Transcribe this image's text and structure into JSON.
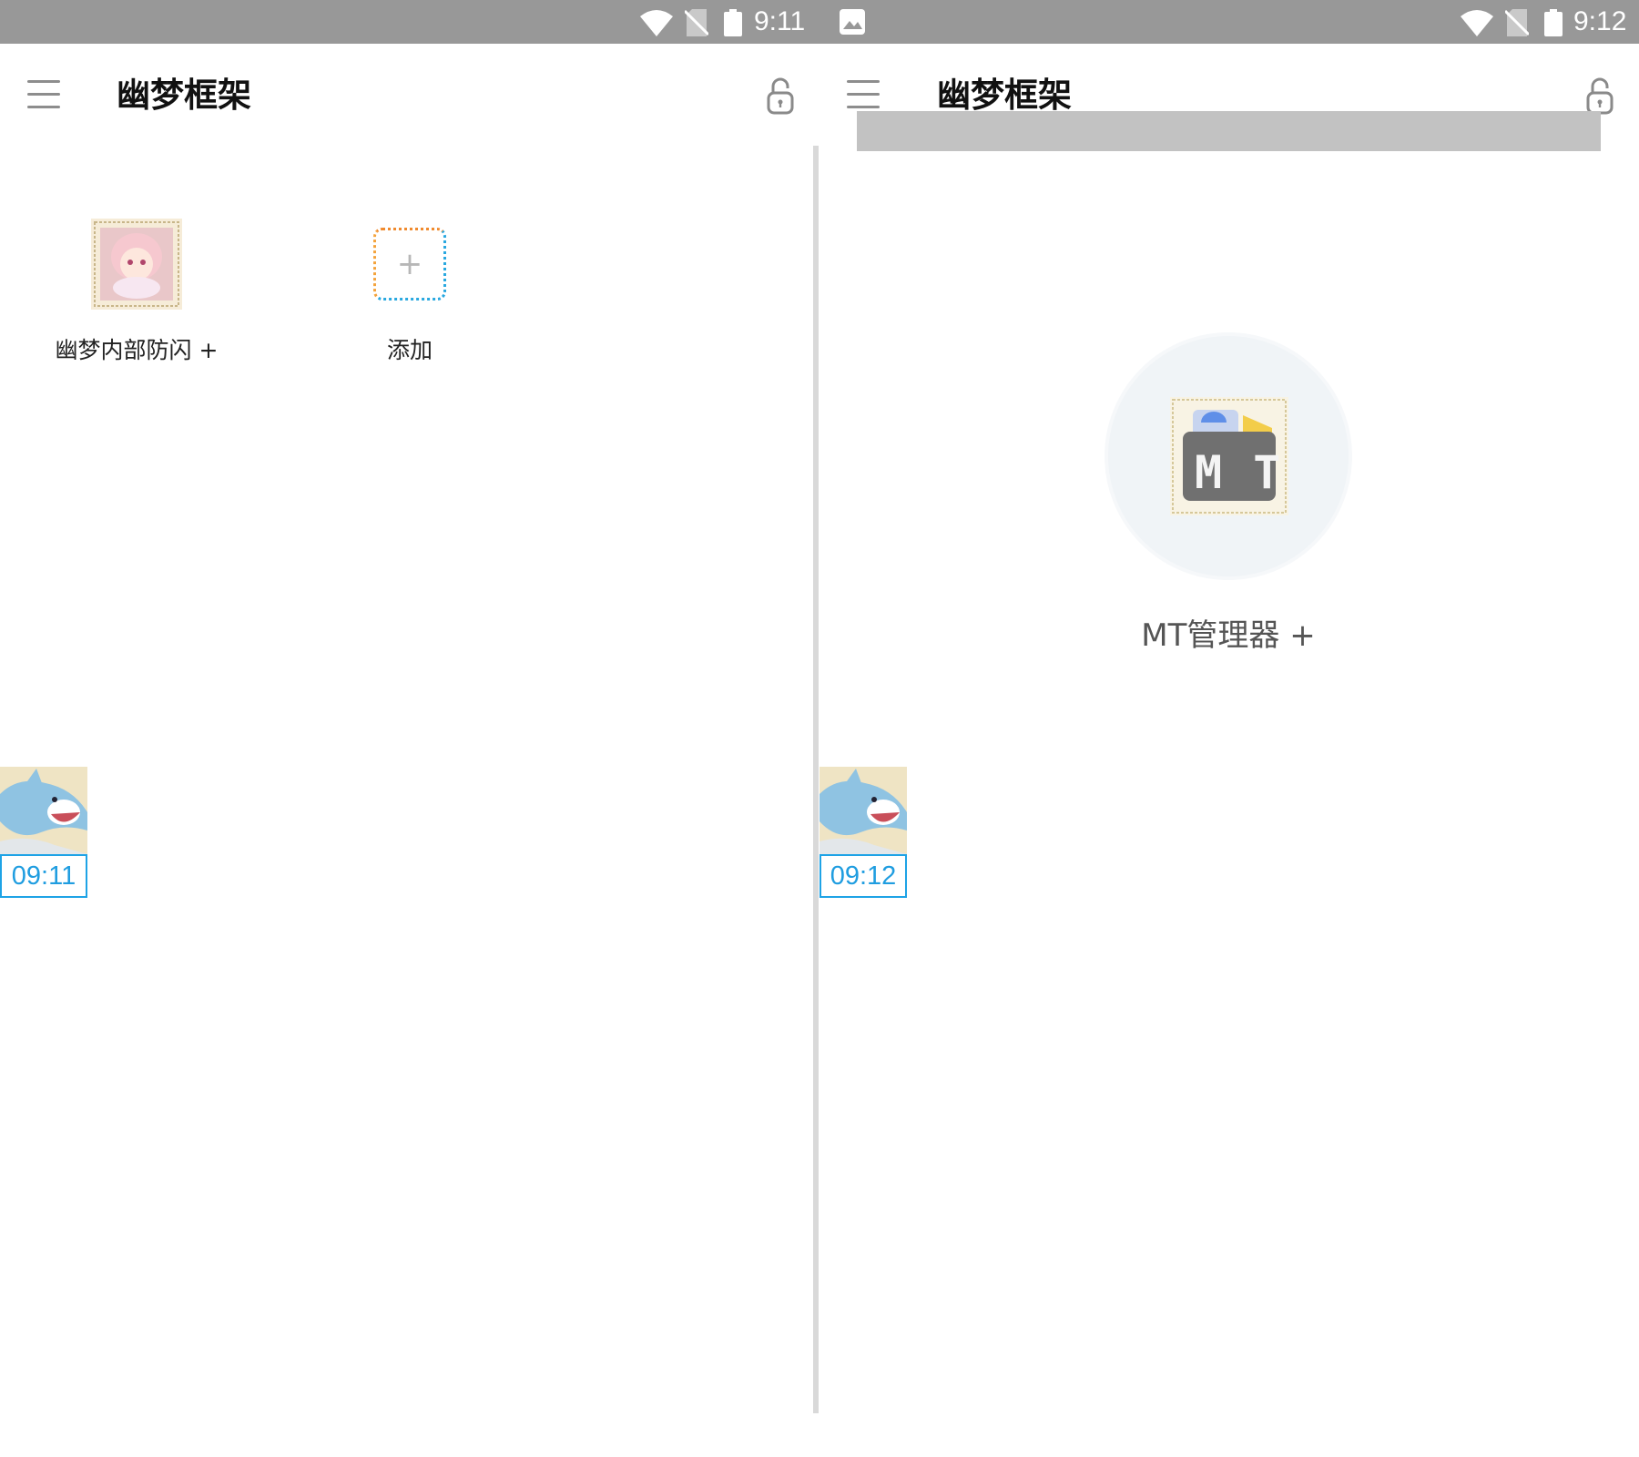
{
  "left": {
    "status_time": "9:11",
    "title": "幽梦框架",
    "tiles": [
      {
        "label": "幽梦内部防闪 +"
      },
      {
        "label": "添加",
        "add_glyph": "+"
      }
    ],
    "float_time": "09:11"
  },
  "right": {
    "status_time": "9:12",
    "title": "幽梦框架",
    "app_icon_text": "M T",
    "app_label": "MT管理器 +",
    "float_time": "09:12"
  },
  "icons": {
    "wifi": "wifi-icon",
    "no_sim": "no-sim-icon",
    "battery": "battery-icon",
    "image": "image-notification-icon",
    "menu": "hamburger-menu-icon",
    "lock": "unlock-icon",
    "avatar": "anime-girl-avatar",
    "shark": "shark-thumbnail"
  },
  "colors": {
    "status_bar": "#989898",
    "accent_blue": "#1f9de0",
    "divider": "#d9d9d9",
    "overlay_bar": "#c2c2c2",
    "app_circle": "#f0f4f7"
  }
}
